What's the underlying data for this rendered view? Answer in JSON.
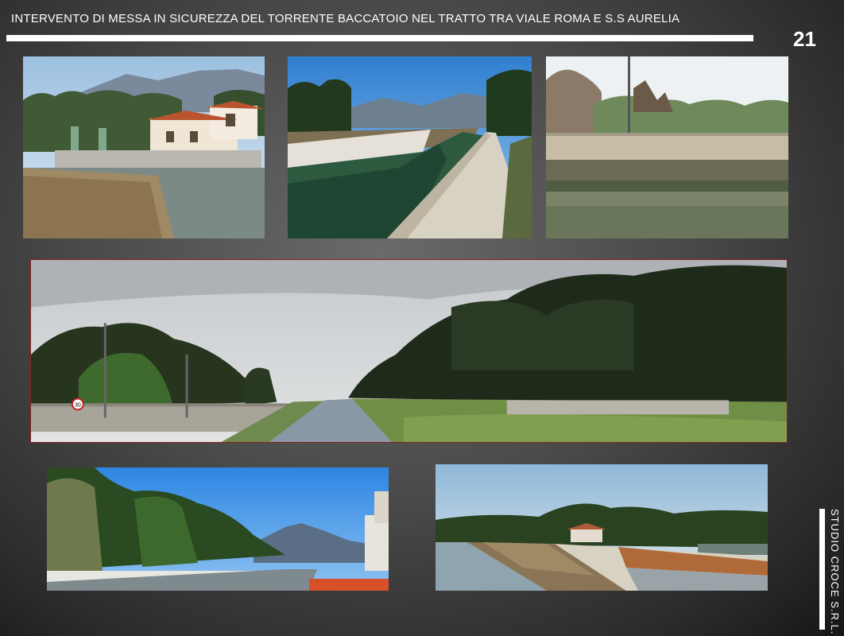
{
  "slide": {
    "title": "INTERVENTO DI MESSA IN SICUREZZA DEL TORRENTE BACCATOIO NEL TRATTO TRA VIALE ROMA E S.S AURELIA",
    "page_number": "21",
    "author": "STUDIO CROCE S.R.L."
  },
  "photos": {
    "p1": {
      "sign": ""
    },
    "p4": {
      "sign": "30"
    }
  }
}
